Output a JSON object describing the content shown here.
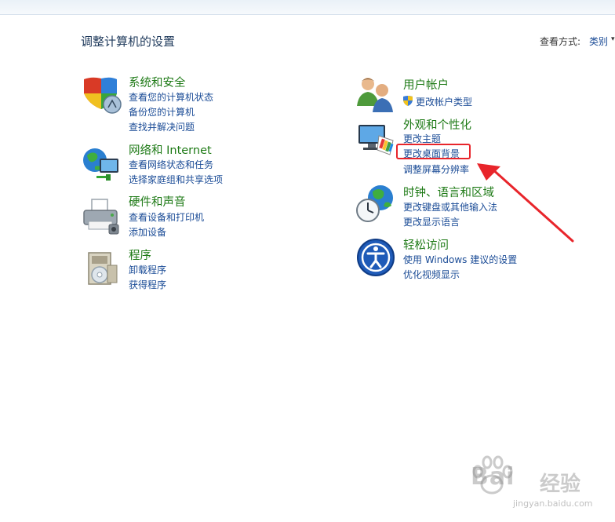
{
  "page_title": "调整计算机的设置",
  "view_by": {
    "label": "查看方式:",
    "value": "类别"
  },
  "categories_left": [
    {
      "title": "系统和安全",
      "icon": "security-shield-icon",
      "links": [
        "查看您的计算机状态",
        "备份您的计算机",
        "查找并解决问题"
      ]
    },
    {
      "title": "网络和 Internet",
      "icon": "network-globe-icon",
      "links": [
        "查看网络状态和任务",
        "选择家庭组和共享选项"
      ]
    },
    {
      "title": "硬件和声音",
      "icon": "printer-hardware-icon",
      "links": [
        "查看设备和打印机",
        "添加设备"
      ]
    },
    {
      "title": "程序",
      "icon": "programs-disc-icon",
      "links": [
        "卸载程序",
        "获得程序"
      ]
    }
  ],
  "categories_right": [
    {
      "title": "用户帐户",
      "icon": "users-icon",
      "links": [
        "更改帐户类型"
      ]
    },
    {
      "title": "外观和个性化",
      "icon": "display-palette-icon",
      "links": [
        "更改主题",
        "更改桌面背景",
        "调整屏幕分辨率"
      ]
    },
    {
      "title": "时钟、语言和区域",
      "icon": "clock-globe-icon",
      "links": [
        "更改键盘或其他输入法",
        "更改显示语言"
      ]
    },
    {
      "title": "轻松访问",
      "icon": "ease-of-access-icon",
      "links": [
        "使用 Windows 建议的设置",
        "优化视频显示"
      ]
    }
  ],
  "annotation": {
    "highlight_color": "#e8252b",
    "highlighted_link": "更改桌面背景"
  },
  "watermark": {
    "brand": "Bai",
    "name": "经验",
    "url": "jingyan.baidu.com"
  }
}
